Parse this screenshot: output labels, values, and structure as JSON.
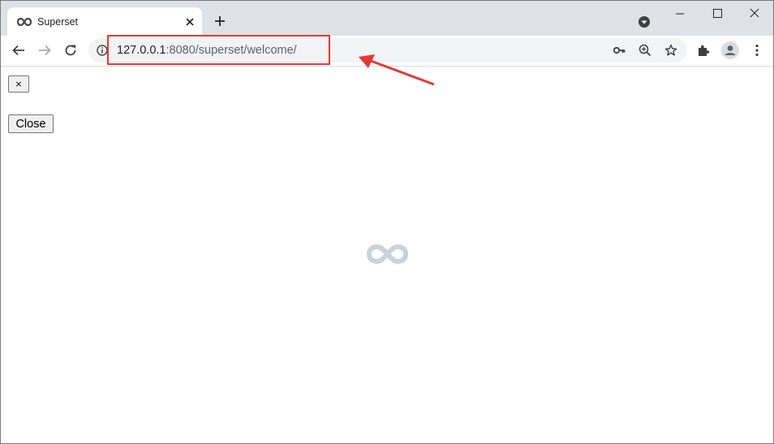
{
  "browser": {
    "tab": {
      "title": "Superset",
      "favicon": "superset-logo-icon"
    },
    "address_bar": {
      "url_host": "127.0.0.1",
      "url_rest": ":8080/superset/welcome/"
    },
    "toolbar_icons": [
      "back-icon",
      "forward-icon",
      "reload-icon",
      "info-icon",
      "key-icon",
      "zoom-icon",
      "star-icon",
      "extensions-icon",
      "profile-icon",
      "menu-icon"
    ]
  },
  "page": {
    "dismiss_button_label": "×",
    "close_button_label": "Close",
    "loader": "superset-loading-icon"
  },
  "annotation": {
    "color": "#e53935",
    "highlights": "address-bar-url"
  },
  "colors": {
    "tab_strip": "#dee1e6",
    "omnibox": "#f1f3f4",
    "loader": "#c9d3dc"
  }
}
